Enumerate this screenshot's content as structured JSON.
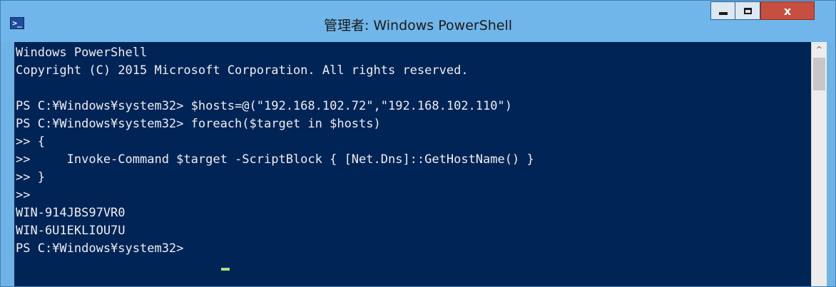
{
  "window": {
    "title": "管理者: Windows PowerShell",
    "icon": "powershell-icon",
    "controls": {
      "minimize": "minimize-icon",
      "maximize": "maximize-icon",
      "close": "x"
    }
  },
  "console": {
    "lines": [
      "Windows PowerShell",
      "Copyright (C) 2015 Microsoft Corporation. All rights reserved.",
      "",
      "PS C:¥Windows¥system32> $hosts=@(\"192.168.102.72\",\"192.168.102.110\")",
      "PS C:¥Windows¥system32> foreach($target in $hosts)",
      ">> {",
      ">>     Invoke-Command $target -ScriptBlock { [Net.Dns]::GetHostName() }",
      ">> }",
      ">>",
      "WIN-914JBS97VR0",
      "WIN-6U1EKLIOU7U",
      "PS C:¥Windows¥system32> "
    ]
  },
  "scrollbar": {
    "up_arrow": "^"
  },
  "colors": {
    "console_bg": "#012456",
    "console_text": "#eeedf0",
    "cursor": "#a8e07a",
    "titlebar": "#70b6ea",
    "close_button": "#c74f3f"
  }
}
